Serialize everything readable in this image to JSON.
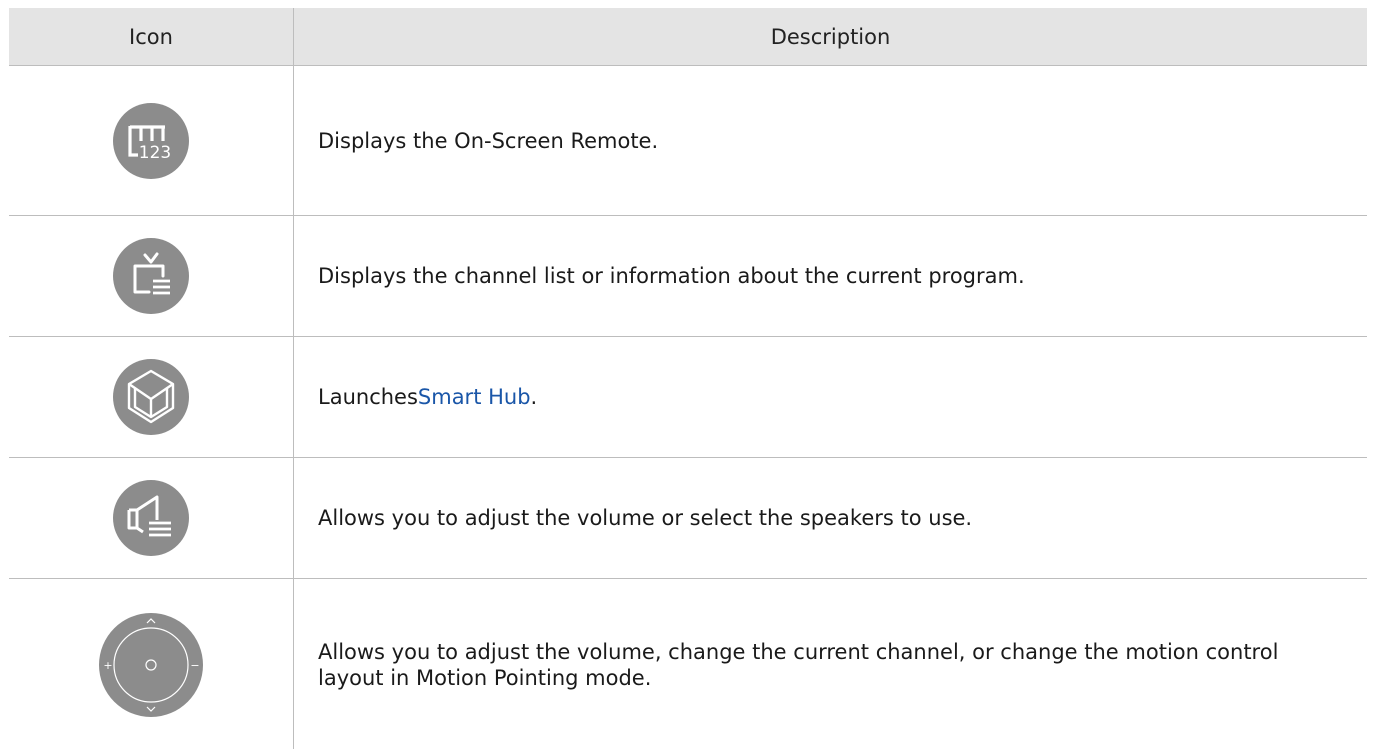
{
  "table": {
    "headers": {
      "icon": "Icon",
      "description": "Description"
    },
    "rows": [
      {
        "icon": "on-screen-remote-icon",
        "description": "Displays the On-Screen Remote."
      },
      {
        "icon": "channel-list-icon",
        "description": "Displays the channel list or information about the current program."
      },
      {
        "icon": "smart-hub-icon",
        "prefix": "Launches ",
        "link": "Smart Hub",
        "suffix": "."
      },
      {
        "icon": "speaker-volume-icon",
        "description": "Allows you to adjust the volume or select the speakers to use."
      },
      {
        "icon": "motion-control-pad-icon",
        "description": "Allows you to adjust the volume, change the current channel, or change the motion control layout in Motion Pointing mode.",
        "pad_labels": {
          "plus": "+",
          "minus": "−"
        }
      }
    ],
    "remote_icon_text": "123"
  },
  "colors": {
    "icon_fill": "#8c8c8c",
    "header_bg": "#e4e4e4",
    "link": "#1a56a8",
    "border": "#bdbdbd"
  }
}
